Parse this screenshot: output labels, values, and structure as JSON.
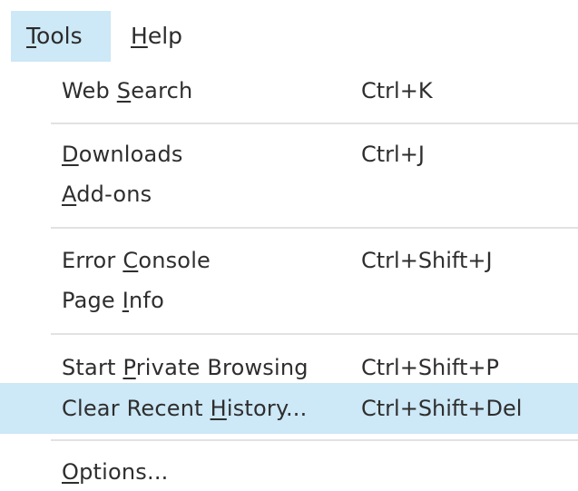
{
  "menubar": {
    "items": [
      {
        "pre": "",
        "mn": "T",
        "post": "ools"
      },
      {
        "pre": "",
        "mn": "H",
        "post": "elp"
      }
    ]
  },
  "menu": {
    "items": [
      {
        "pre": "Web ",
        "mn": "S",
        "post": "earch",
        "shortcut": "Ctrl+K"
      },
      {
        "pre": "",
        "mn": "D",
        "post": "ownloads",
        "shortcut": "Ctrl+J"
      },
      {
        "pre": "",
        "mn": "A",
        "post": "dd-ons",
        "shortcut": ""
      },
      {
        "pre": "Error ",
        "mn": "C",
        "post": "onsole",
        "shortcut": "Ctrl+Shift+J"
      },
      {
        "pre": "Page ",
        "mn": "I",
        "post": "nfo",
        "shortcut": ""
      },
      {
        "pre": "Start ",
        "mn": "P",
        "post": "rivate Browsing",
        "shortcut": "Ctrl+Shift+P"
      },
      {
        "pre": "Clear Recent ",
        "mn": "H",
        "post": "istory...",
        "shortcut": "Ctrl+Shift+Del"
      },
      {
        "pre": "",
        "mn": "O",
        "post": "ptions...",
        "shortcut": ""
      }
    ]
  },
  "colors": {
    "highlight": "#cde8f6",
    "separator": "#e2e2e2",
    "text": "#2e2e2e"
  }
}
